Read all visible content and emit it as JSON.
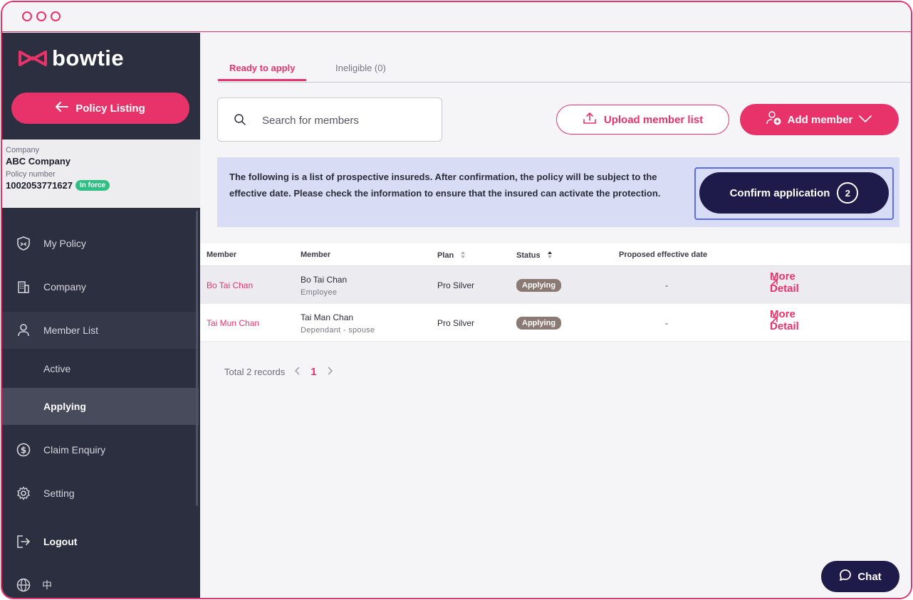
{
  "brand": {
    "name": "bowtie",
    "color": "#e8336a"
  },
  "sidebar": {
    "policy_listing_label": "Policy Listing",
    "company": {
      "company_label": "Company",
      "company_name": "ABC Company",
      "policy_label": "Policy number",
      "policy_number": "1002053771627",
      "status": "In force"
    },
    "nav": [
      {
        "label": "My Policy",
        "icon": "shield-icon"
      },
      {
        "label": "Company",
        "icon": "building-icon"
      },
      {
        "label": "Member List",
        "icon": "user-icon"
      },
      {
        "label": "Active"
      },
      {
        "label": "Applying"
      },
      {
        "label": "Claim Enquiry",
        "icon": "dollar-icon"
      },
      {
        "label": "Setting",
        "icon": "gear-icon"
      },
      {
        "label": "Logout",
        "icon": "logout-icon"
      },
      {
        "label": "中",
        "icon": "globe-icon"
      }
    ]
  },
  "main": {
    "tabs": [
      {
        "label": "Ready to apply",
        "active": true
      },
      {
        "label": "Ineligible (0)",
        "active": false
      }
    ],
    "search": {
      "placeholder": "Search for members",
      "value": ""
    },
    "upload_label": "Upload member list",
    "add_member_label": "Add member",
    "notice": "The following is a list of prospective insureds. After confirmation, the policy will be subject to the effective date. Please check the information to ensure that the insured can activate the protection.",
    "confirm_label": "Confirm application",
    "confirm_count": "2",
    "table": {
      "headers": [
        "Member",
        "Member",
        "Plan",
        "Status",
        "Proposed effective date"
      ],
      "rows": [
        {
          "member_link": "Bo Tai Chan",
          "name": "Bo Tai Chan",
          "relation": "Employee",
          "plan": "Pro Silver",
          "status": "Applying",
          "effective_date": "-",
          "action": "More Detail"
        },
        {
          "member_link": "Tai Mun Chan",
          "name": "Tai Man Chan",
          "relation": "Dependant - spouse",
          "plan": "Pro Silver",
          "status": "Applying",
          "effective_date": "-",
          "action": "More Detail"
        }
      ]
    },
    "pagination": {
      "total": "Total 2 records",
      "current": "1"
    }
  },
  "chat_label": "Chat"
}
